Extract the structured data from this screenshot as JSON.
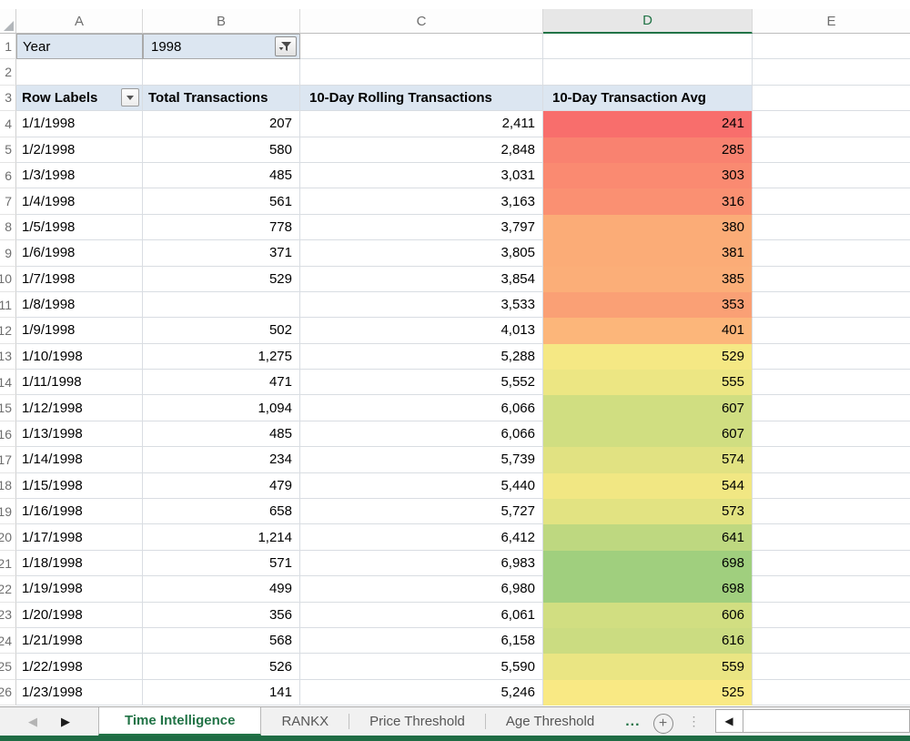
{
  "colors": {
    "excel_green": "#217346",
    "status_bar_green": "#1f6c44",
    "pivot_header_fill": "#dce6f1",
    "selected_column_fill": "#e7e7e7",
    "gridline": "#d9dde2"
  },
  "column_headers": {
    "letters": [
      "A",
      "B",
      "C",
      "D",
      "E"
    ],
    "selected": "D"
  },
  "row_numbers_static": [
    "1",
    "2",
    "3"
  ],
  "filter_row": {
    "label": "Year",
    "value": "1998",
    "filter_icon": "funnel-with-dropdown"
  },
  "table": {
    "headers": {
      "row_labels": "Row Labels",
      "total": "Total Transactions",
      "rolling": "10-Day Rolling Transactions",
      "avg": "10-Day Transaction Avg"
    },
    "rows": [
      {
        "n": "4",
        "date": "1/1/1998",
        "total": "207",
        "rolling": "2,411",
        "avg": "241",
        "avg_color": "#F86E6C"
      },
      {
        "n": "5",
        "date": "1/2/1998",
        "total": "580",
        "rolling": "2,848",
        "avg": "285",
        "avg_color": "#F98270"
      },
      {
        "n": "6",
        "date": "1/3/1998",
        "total": "485",
        "rolling": "3,031",
        "avg": "303",
        "avg_color": "#FA8A71"
      },
      {
        "n": "7",
        "date": "1/4/1998",
        "total": "561",
        "rolling": "3,163",
        "avg": "316",
        "avg_color": "#FA9072"
      },
      {
        "n": "8",
        "date": "1/5/1998",
        "total": "778",
        "rolling": "3,797",
        "avg": "380",
        "avg_color": "#FBAC77"
      },
      {
        "n": "9",
        "date": "1/6/1998",
        "total": "371",
        "rolling": "3,805",
        "avg": "381",
        "avg_color": "#FBAC77"
      },
      {
        "n": "10",
        "date": "1/7/1998",
        "total": "529",
        "rolling": "3,854",
        "avg": "385",
        "avg_color": "#FBAE78"
      },
      {
        "n": "11",
        "date": "1/8/1998",
        "total": "",
        "rolling": "3,533",
        "avg": "353",
        "avg_color": "#FAA075"
      },
      {
        "n": "12",
        "date": "1/9/1998",
        "total": "502",
        "rolling": "4,013",
        "avg": "401",
        "avg_color": "#FCB67A"
      },
      {
        "n": "13",
        "date": "1/10/1998",
        "total": "1,275",
        "rolling": "5,288",
        "avg": "529",
        "avg_color": "#F5E884"
      },
      {
        "n": "14",
        "date": "1/11/1998",
        "total": "471",
        "rolling": "5,552",
        "avg": "555",
        "avg_color": "#ECE683"
      },
      {
        "n": "15",
        "date": "1/12/1998",
        "total": "1,094",
        "rolling": "6,066",
        "avg": "607",
        "avg_color": "#D0DE81"
      },
      {
        "n": "16",
        "date": "1/13/1998",
        "total": "485",
        "rolling": "6,066",
        "avg": "607",
        "avg_color": "#D0DE81"
      },
      {
        "n": "17",
        "date": "1/14/1998",
        "total": "234",
        "rolling": "5,739",
        "avg": "574",
        "avg_color": "#E1E282"
      },
      {
        "n": "18",
        "date": "1/15/1998",
        "total": "479",
        "rolling": "5,440",
        "avg": "544",
        "avg_color": "#F1E783"
      },
      {
        "n": "19",
        "date": "1/16/1998",
        "total": "658",
        "rolling": "5,727",
        "avg": "573",
        "avg_color": "#E2E382"
      },
      {
        "n": "20",
        "date": "1/17/1998",
        "total": "1,214",
        "rolling": "6,412",
        "avg": "641",
        "avg_color": "#BED880"
      },
      {
        "n": "21",
        "date": "1/18/1998",
        "total": "571",
        "rolling": "6,983",
        "avg": "698",
        "avg_color": "#A0CF7E"
      },
      {
        "n": "22",
        "date": "1/19/1998",
        "total": "499",
        "rolling": "6,980",
        "avg": "698",
        "avg_color": "#A0CF7E"
      },
      {
        "n": "23",
        "date": "1/20/1998",
        "total": "356",
        "rolling": "6,061",
        "avg": "606",
        "avg_color": "#D1DE81"
      },
      {
        "n": "24",
        "date": "1/21/1998",
        "total": "568",
        "rolling": "6,158",
        "avg": "616",
        "avg_color": "#CBDC81"
      },
      {
        "n": "25",
        "date": "1/22/1998",
        "total": "526",
        "rolling": "5,590",
        "avg": "559",
        "avg_color": "#EAE583"
      },
      {
        "n": "26",
        "date": "1/23/1998",
        "total": "141",
        "rolling": "5,246",
        "avg": "525",
        "avg_color": "#F9E984"
      }
    ]
  },
  "tabbar": {
    "nav_left": "◀",
    "nav_right": "▶",
    "tabs": [
      {
        "label": "Time Intelligence",
        "active": true
      },
      {
        "label": "RANKX",
        "active": false
      },
      {
        "label": "Price Threshold",
        "active": false
      },
      {
        "label": "Age Threshold",
        "active": false
      }
    ],
    "more_label": "...",
    "new_sheet": "+",
    "dots": "⋮",
    "scroll_left_arrow": "◀"
  }
}
